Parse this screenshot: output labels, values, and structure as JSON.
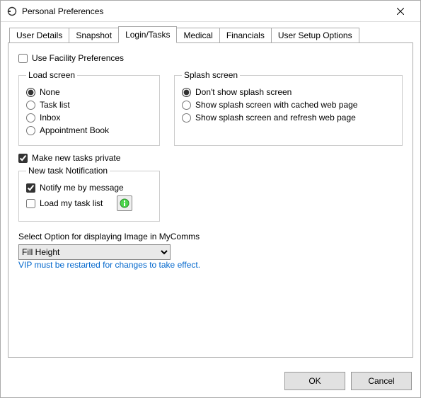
{
  "window": {
    "title": "Personal Preferences"
  },
  "tabs": {
    "t0": "User Details",
    "t1": "Snapshot",
    "t2": "Login/Tasks",
    "t3": "Medical",
    "t4": "Financials",
    "t5": "User Setup Options"
  },
  "main": {
    "use_facility_label": "Use Facility Preferences",
    "load_screen": {
      "legend": "Load screen",
      "none": "None",
      "tasklist": "Task list",
      "inbox": "Inbox",
      "appt": "Appointment Book"
    },
    "splash": {
      "legend": "Splash screen",
      "dont": "Don't show splash screen",
      "cached": "Show splash screen with cached web page",
      "refresh": "Show splash screen and refresh web page"
    },
    "make_private_label": "Make new tasks private",
    "notif": {
      "legend": "New task Notification",
      "notify_msg": "Notify me by message",
      "load_list": "Load my task list"
    },
    "mycomms_label": "Select Option for displaying Image in MyComms",
    "mycomms_value": "Fill Height",
    "restart_note": "VIP must be restarted for changes to take effect."
  },
  "footer": {
    "ok": "OK",
    "cancel": "Cancel"
  }
}
